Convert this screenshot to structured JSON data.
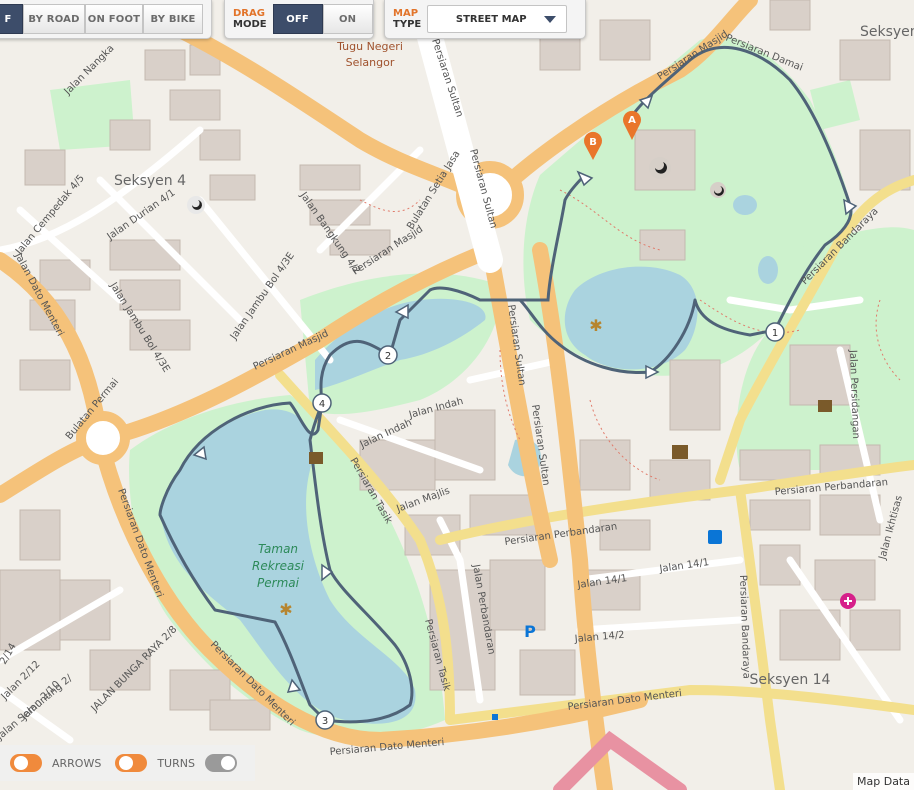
{
  "controls": {
    "route_modes": [
      {
        "label": "F",
        "active": true
      },
      {
        "label": "BY ROAD",
        "active": false
      },
      {
        "label": "ON FOOT",
        "active": false
      },
      {
        "label": "BY BIKE",
        "active": false
      }
    ],
    "drag_mode": {
      "title_top": "DRAG",
      "title_bottom": "MODE",
      "off_label": "OFF",
      "on_label": "ON",
      "selected": "OFF"
    },
    "map_type": {
      "title_top": "MAP",
      "title_bottom": "TYPE",
      "value": "STREET MAP"
    }
  },
  "toggles": {
    "arrows_label": "ARROWS",
    "turns_label": "TURNS",
    "first_on": true,
    "arrows_on": true,
    "turns_on": false
  },
  "map": {
    "labels": {
      "tugu1": "Tugu Negeri",
      "tugu2": "Selangor",
      "seksyen4": "Seksyen 4",
      "seksyen14": "Seksyen 14",
      "seksyen_tr": "Seksyen",
      "taman1": "Taman",
      "taman2": "Rekreasi",
      "taman3": "Permai",
      "p_sultan_top": "Persiaran Sultan",
      "p_sultan_mid": "Persiaran Sultan",
      "p_sultan_low": "Persiaran Sultan",
      "p_masjid_top": "Persiaran Masjid",
      "p_masjid_mid": "Persiaran Masjid",
      "p_masjid_low": "Persiaran Masjid",
      "p_damai": "Persiaran Damai",
      "p_bandaraya": "Persiaran Bandaraya",
      "p_bandaraya2": "Persiaran Bandaraya",
      "p_perbandaran": "Persiaran Perbandaran",
      "p_perbandaran_r": "Persiaran Perbandaran",
      "p_dato_menteri": "Persiaran Dato Menteri",
      "p_dato_menteri_b": "Persiaran Dato Menteri",
      "p_dato_menteri_l": "Persiaran Dato Menteri",
      "p_dato_menteri_r": "Persiaran Dato Menteri",
      "p_dato_menteri_left": "Jalan Dato Menteri",
      "p_tasik": "Persiaran Tasik",
      "p_tasik2": "Persiaran Tasik",
      "bulatan_permai": "Bulatan Permai",
      "bulatan_setia": "Bulatan Setia Jasa",
      "jalan_indah1": "Jalan Indah",
      "jalan_indah2": "Jalan Indah",
      "jalan_majlis": "Jalan Majlis",
      "jalan_perbandaran": "Jalan Perbandaran",
      "jalan_14_1a": "Jalan 14/1",
      "jalan_14_1b": "Jalan 14/1",
      "jalan_14_2": "Jalan 14/2",
      "jalan_persidangan": "Jalan Persidangan",
      "jalan_ikhtisas": "Jalan Ikhtisas",
      "jalan_nangka": "Jalan Nangka",
      "jalan_cempedak": "Jalan Cempedak 4/5",
      "jalan_durian": "Jalan Durian 4/1",
      "jalan_bangkung": "Jalan Bangkung 4/2",
      "jalan_jambu": "Jalan Jambu Bol 4/3E",
      "jalan_jambu2": "Jalan Jambu Bol 4/3E",
      "jalan_bunga": "JALAN BUNGA RAYA 2/8",
      "jalan_212": "Jalan 2/12",
      "jalan_210": "Jalan 2/10",
      "jalan_214": "2/14",
      "jalan_semunting": "Jalan Semunting 2/"
    },
    "markers": {
      "a": "A",
      "b": "B"
    },
    "waypoints": [
      "1",
      "2",
      "3",
      "4"
    ],
    "attribution": "Map Data"
  }
}
